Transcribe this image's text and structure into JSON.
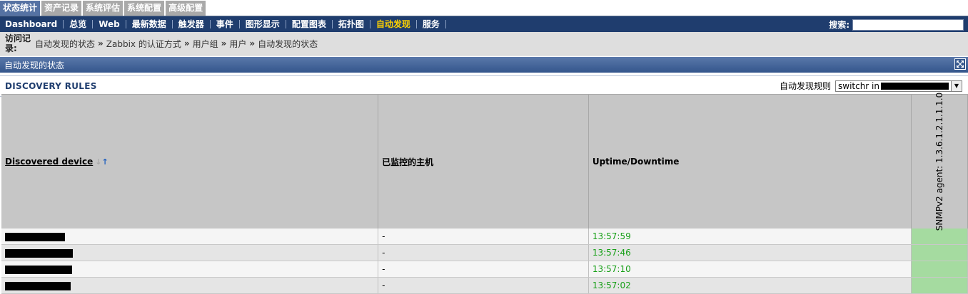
{
  "top_tabs": [
    "状态统计",
    "资产记录",
    "系统评估",
    "系统配置",
    "高级配置"
  ],
  "nav": [
    "Dashboard",
    "总览",
    "Web",
    "最新数据",
    "触发器",
    "事件",
    "图形显示",
    "配置图表",
    "拓扑图",
    "自动发现",
    "服务"
  ],
  "nav_active_index": 9,
  "search": {
    "label": "搜索:",
    "value": ""
  },
  "history": {
    "label": "访问记录:",
    "links": [
      "自动发现的状态",
      "Zabbix 的认证方式",
      "用户组",
      "用户",
      "自动发现的状态"
    ],
    "separator": "»"
  },
  "widget": {
    "title": "自动发现的状态"
  },
  "rules": {
    "title": "DISCOVERY RULES",
    "filter_label": "自动发现规则",
    "selected_rule": "switchr in"
  },
  "table": {
    "headers": {
      "device": "Discovered device",
      "monitored": "已监控的主机",
      "uptime": "Uptime/Downtime",
      "check": "SNMPv2 agent: 1.3.6.1.2.1.1.1.0"
    },
    "rows": [
      {
        "monitored": "-",
        "uptime": "13:57:59"
      },
      {
        "monitored": "-",
        "uptime": "13:57:46"
      },
      {
        "monitored": "-",
        "uptime": "13:57:10"
      },
      {
        "monitored": "-",
        "uptime": "13:57:02"
      }
    ]
  },
  "colors": {
    "nav_bg": "#1f3d6e",
    "active_nav": "#ffd200",
    "uptime_green": "#18a018",
    "status_green": "#a5dba0"
  }
}
